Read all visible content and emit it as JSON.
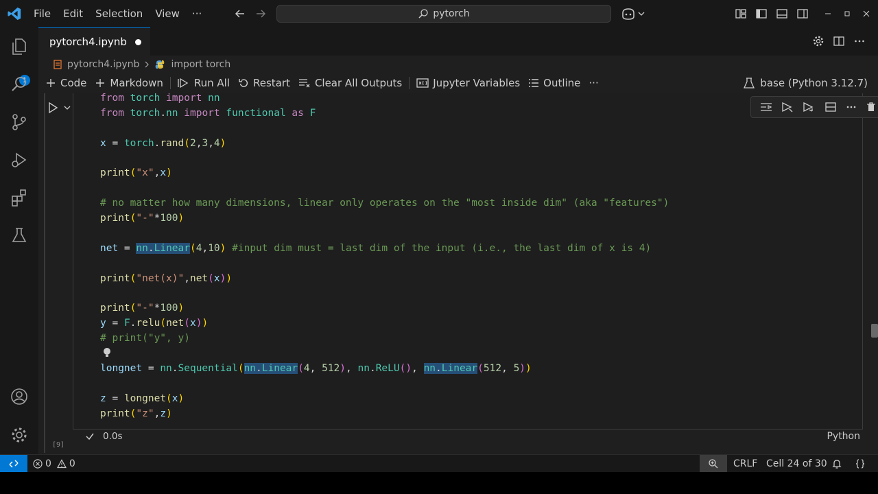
{
  "menu": [
    "File",
    "Edit",
    "Selection",
    "View",
    "···"
  ],
  "command_center": {
    "text": "pytorch"
  },
  "tab": {
    "filename": "pytorch4.ipynb"
  },
  "breadcrumb": {
    "file": "pytorch4.ipynb",
    "symbol": "import torch"
  },
  "toolbar": {
    "code": "Code",
    "markdown": "Markdown",
    "run_all": "Run All",
    "restart": "Restart",
    "clear_outputs": "Clear All Outputs",
    "variables": "Jupyter Variables",
    "outline": "Outline",
    "more": "···",
    "kernel": "base (Python 3.12.7)"
  },
  "activity": {
    "explorer_badge": "1"
  },
  "cell": {
    "exec_count": "[9]",
    "duration": "0.0s",
    "language": "Python"
  },
  "status": {
    "errors": "0",
    "warnings": "0",
    "eol": "CRLF",
    "cell_position": "Cell 24 of 30"
  },
  "colors": {
    "accent": "#0078d4",
    "keyword": "#c586c0",
    "module": "#4ec9b0",
    "function": "#dcdcaa",
    "string": "#ce9178",
    "number": "#b5cea8",
    "comment": "#6a9955",
    "variable": "#9cdcfe",
    "selection": "#264f78"
  }
}
